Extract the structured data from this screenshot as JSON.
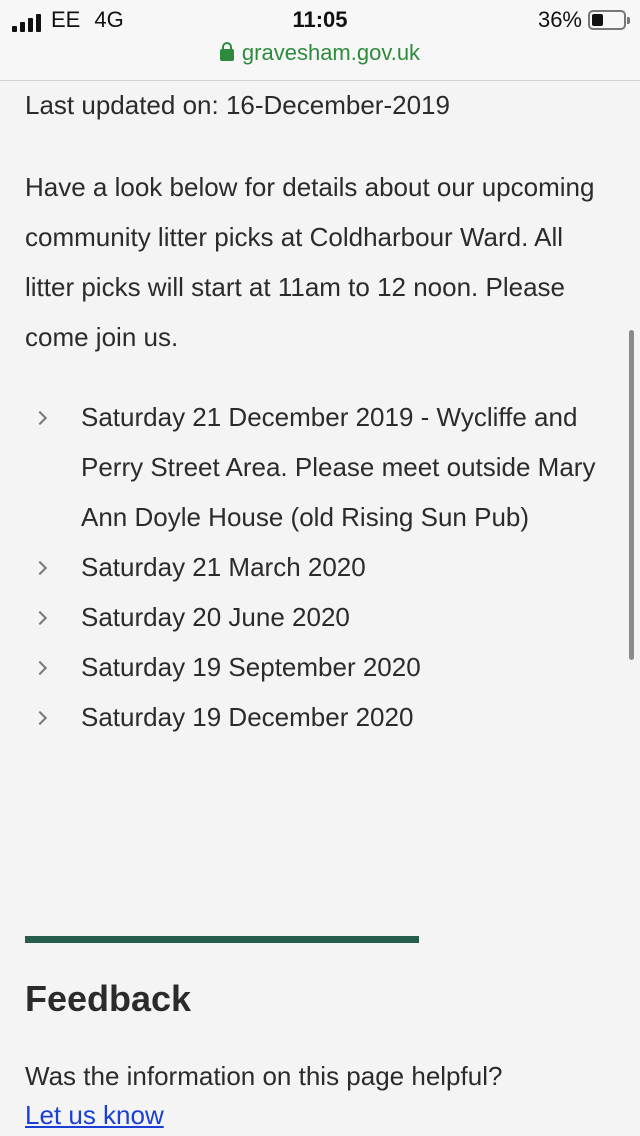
{
  "status_bar": {
    "carrier": "EE",
    "network": "4G",
    "time": "11:05",
    "battery": "36%",
    "url": "gravesham.gov.uk"
  },
  "page": {
    "last_updated": "Last updated on: 16-December-2019",
    "intro": "Have a look below for details about our upcoming community litter picks at Coldharbour Ward. All litter picks will start at 11am to 12 noon. Please come join us.",
    "items": [
      "Saturday 21 December 2019 - Wycliffe and Perry Street Area. Please meet outside Mary Ann Doyle House (old Rising Sun Pub)",
      "Saturday 21 March 2020",
      "Saturday 20 June 2020",
      "Saturday 19 September 2020",
      "Saturday 19 December 2020"
    ]
  },
  "feedback": {
    "title": "Feedback",
    "question": "Was the information on this page helpful?",
    "link_label": "Let us know"
  },
  "icons": {
    "signal": "signal-icon",
    "lock": "lock-icon",
    "battery": "battery-icon",
    "chevron": "chevron-right-icon"
  },
  "colors": {
    "url_green": "#2e8b3e",
    "divider": "#265d4f",
    "link": "#1a3fd6"
  }
}
